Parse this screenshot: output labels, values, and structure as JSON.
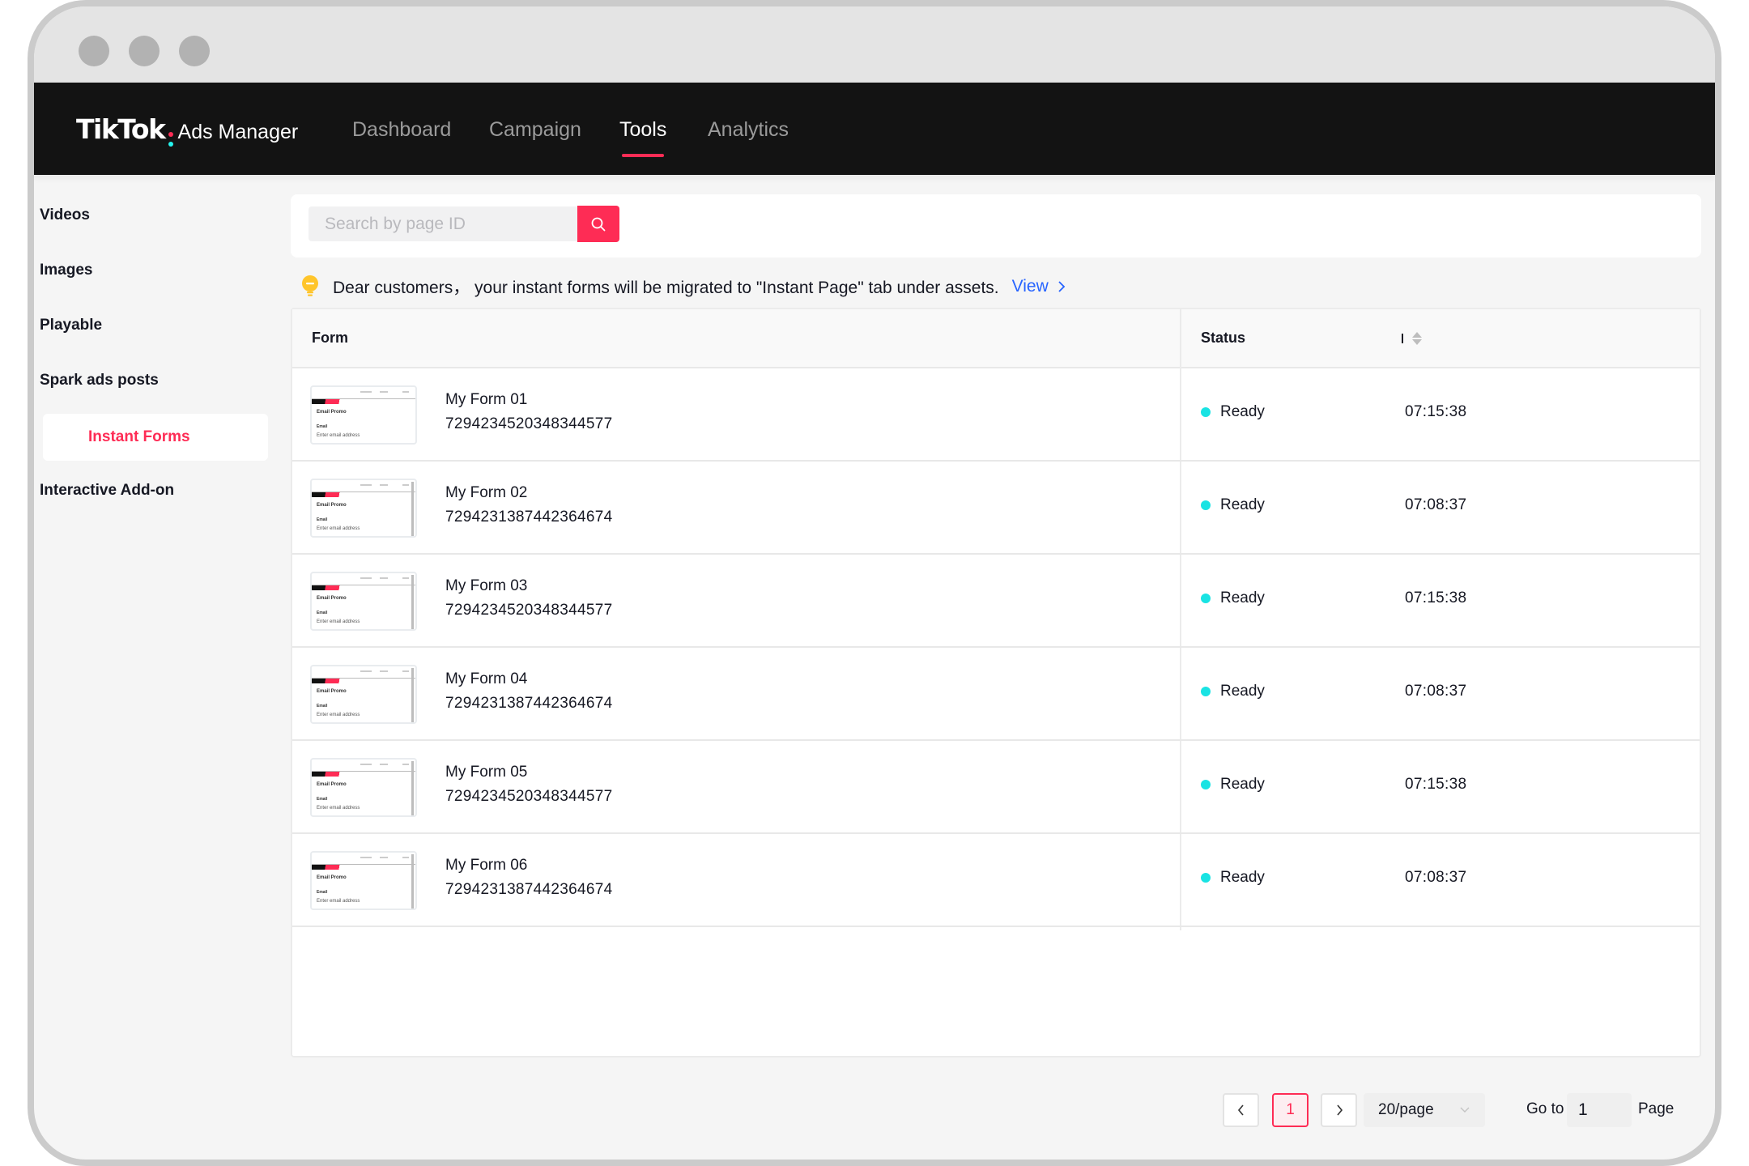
{
  "window": {
    "controls": [
      "close",
      "minimize",
      "maximize"
    ]
  },
  "navbar": {
    "logo_brand": "TikTok",
    "logo_sub": "Ads Manager",
    "items": [
      {
        "label": "Dashboard",
        "active": false
      },
      {
        "label": "Campaign",
        "active": false
      },
      {
        "label": "Tools",
        "active": true
      },
      {
        "label": "Analytics",
        "active": false
      }
    ]
  },
  "sidebar": {
    "items": [
      {
        "label": "Videos",
        "active": false
      },
      {
        "label": "Images",
        "active": false
      },
      {
        "label": "Playable",
        "active": false
      },
      {
        "label": "Spark ads posts",
        "active": false
      },
      {
        "label": "Instant Forms",
        "active": true
      },
      {
        "label": "Interactive Add-on",
        "active": false
      }
    ]
  },
  "search": {
    "placeholder": "Search by page ID",
    "value": "",
    "button_icon": "search-icon"
  },
  "notice": {
    "icon": "lightbulb-icon",
    "text": "Dear customers，  your instant forms will be migrated to \"Instant Page\" tab under assets.",
    "link_label": "View",
    "link_icon": "chevron-right-icon"
  },
  "table": {
    "columns": [
      {
        "label": "Form"
      },
      {
        "label": "Status"
      },
      {
        "label": "",
        "sortable": true
      }
    ],
    "thumbnail": {
      "title": "Email Promo",
      "field_label": "Email",
      "field_placeholder": "Enter email address"
    },
    "rows": [
      {
        "name": "My Form 01",
        "id": "7294234520348344577",
        "status": "Ready",
        "time": "07:15:38"
      },
      {
        "name": "My Form 02",
        "id": "7294231387442364674",
        "status": "Ready",
        "time": "07:08:37"
      },
      {
        "name": "My Form 03",
        "id": "7294234520348344577",
        "status": "Ready",
        "time": "07:15:38"
      },
      {
        "name": "My Form 04",
        "id": "7294231387442364674",
        "status": "Ready",
        "time": "07:08:37"
      },
      {
        "name": "My Form 05",
        "id": "7294234520348344577",
        "status": "Ready",
        "time": "07:15:38"
      },
      {
        "name": "My Form 06",
        "id": "7294231387442364674",
        "status": "Ready",
        "time": "07:08:37"
      }
    ]
  },
  "pagination": {
    "prev_icon": "chevron-left-icon",
    "current_page": "1",
    "next_icon": "chevron-right-icon",
    "page_size": "20/page",
    "goto_label": "Go to",
    "goto_value": "1",
    "page_label": "Page"
  },
  "colors": {
    "brand_pink": "#fe2c55",
    "brand_cyan": "#25f4ee",
    "status_ready": "#19e3e3",
    "link_blue": "#2764ff",
    "nav_bg": "#131313",
    "bulb_yellow": "#ffc52b"
  }
}
